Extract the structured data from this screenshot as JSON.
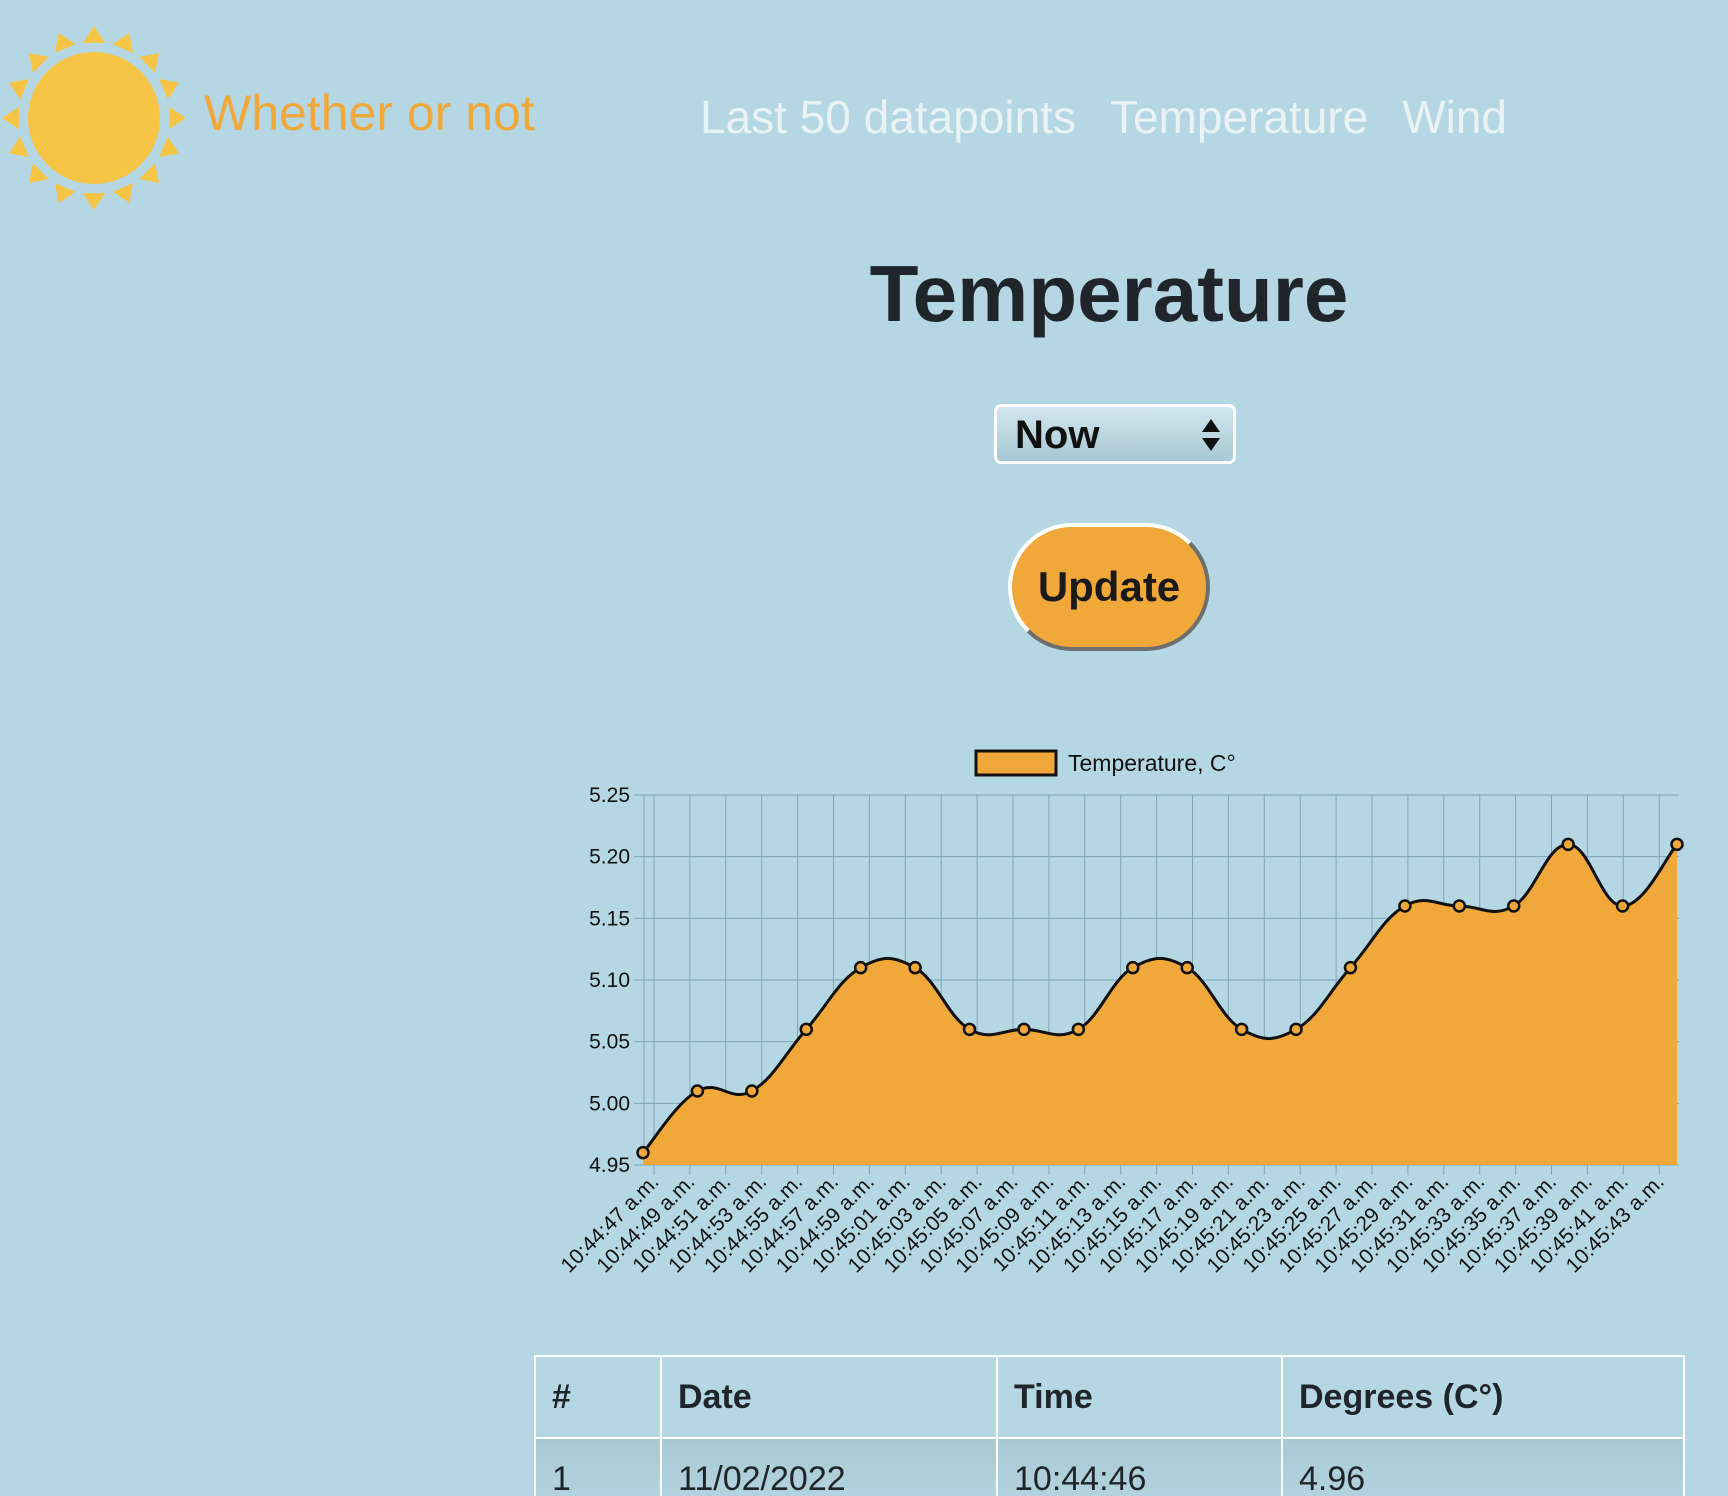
{
  "header": {
    "brand": "Whether or not",
    "nav": [
      "Last 50 datapoints",
      "Temperature",
      "Wind"
    ]
  },
  "page": {
    "title": "Temperature",
    "select_value": "Now",
    "update_label": "Update"
  },
  "colors": {
    "background": "#b5d7e3",
    "accent": "#f1a83a",
    "sun": "#f6c546",
    "grid": "#7fa5b5"
  },
  "chart_data": {
    "type": "area",
    "legend": "Temperature, C°",
    "legend_position": "top-center",
    "grid": true,
    "ylim": [
      4.95,
      5.25
    ],
    "yticks": [
      "5.25",
      "5.20",
      "5.15",
      "5.10",
      "5.05",
      "5.00",
      "4.95"
    ],
    "categories": [
      "10:44:47 a.m.",
      "10:44:49 a.m.",
      "10:44:51 a.m.",
      "10:44:53 a.m.",
      "10:44:55 a.m.",
      "10:44:57 a.m.",
      "10:44:59 a.m.",
      "10:45:01 a.m.",
      "10:45:03 a.m.",
      "10:45:05 a.m.",
      "10:45:07 a.m.",
      "10:45:09 a.m.",
      "10:45:11 a.m.",
      "10:45:13 a.m.",
      "10:45:15 a.m.",
      "10:45:17 a.m.",
      "10:45:19 a.m.",
      "10:45:21 a.m.",
      "10:45:23 a.m.",
      "10:45:25 a.m.",
      "10:45:27 a.m.",
      "10:45:29 a.m.",
      "10:45:31 a.m.",
      "10:45:33 a.m.",
      "10:45:35 a.m.",
      "10:45:37 a.m.",
      "10:45:39 a.m.",
      "10:45:41 a.m.",
      "10:45:43 a.m."
    ],
    "series": [
      {
        "name": "Temperature, C°",
        "values": [
          4.96,
          5.01,
          5.01,
          5.06,
          5.11,
          5.11,
          5.06,
          5.06,
          5.06,
          5.11,
          5.11,
          5.06,
          5.06,
          5.11,
          5.16,
          5.16,
          5.16,
          5.21,
          5.16,
          5.21
        ]
      }
    ]
  },
  "table": {
    "headers": [
      "#",
      "Date",
      "Time",
      "Degrees (C°)"
    ],
    "rows": [
      [
        "1",
        "11/02/2022",
        "10:44:46",
        "4.96"
      ]
    ]
  }
}
